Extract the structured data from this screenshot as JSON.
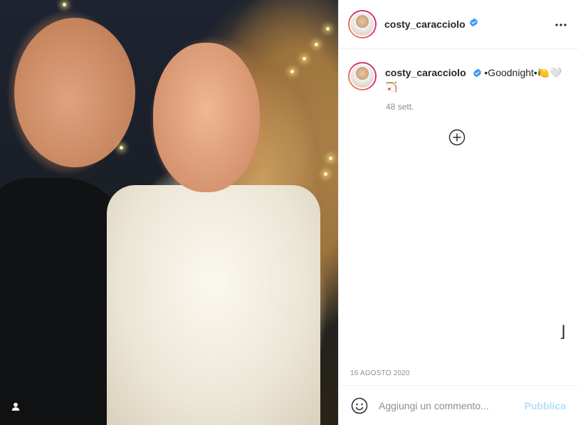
{
  "post": {
    "username": "costy_caracciolo",
    "verified": true,
    "caption": "•Goodnight•🍋🤍",
    "caption_extra": "🏹",
    "time_ago": "48 sett.",
    "date": "16 AGOSTO 2020"
  },
  "comment": {
    "placeholder": "Aggiungi un commento...",
    "publish_label": "Pubblica"
  },
  "icons": {
    "more": "more-options-icon",
    "verified": "verified-badge-icon",
    "add": "plus-circle-icon",
    "emoji": "emoji-icon",
    "user": "user-tag-icon"
  },
  "colors": {
    "verified_blue": "#3897f0",
    "publish_disabled": "#b2dffc",
    "muted_text": "#8e8e8e"
  }
}
